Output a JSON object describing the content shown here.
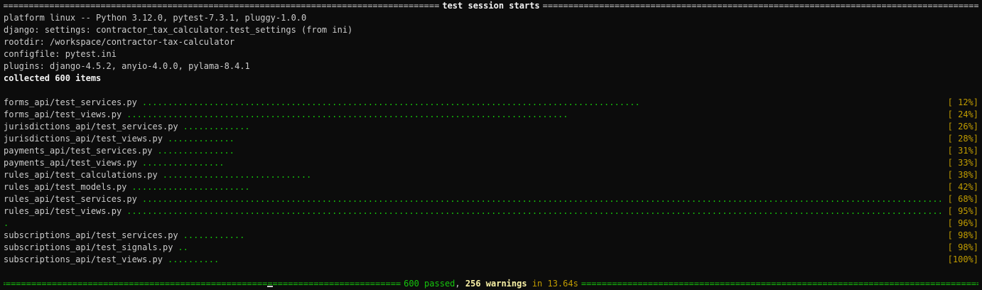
{
  "session_header": "test session starts",
  "info_lines": [
    "platform linux -- Python 3.12.0, pytest-7.3.1, pluggy-1.0.0",
    "django: settings: contractor_tax_calculator.test_settings (from ini)",
    "rootdir: /workspace/contractor-tax-calculator",
    "configfile: pytest.ini",
    "plugins: django-4.5.2, anyio-4.0.0, pylama-8.4.1"
  ],
  "collected": "collected 600 items",
  "results": [
    {
      "file": "forms_api/test_services.py",
      "dots": 97,
      "pct": "[ 12%]"
    },
    {
      "file": "forms_api/test_views.py",
      "dots": 86,
      "pct": "[ 24%]"
    },
    {
      "file": "jurisdictions_api/test_services.py",
      "dots": 13,
      "pct": "[ 26%]"
    },
    {
      "file": "jurisdictions_api/test_views.py",
      "dots": 13,
      "pct": "[ 28%]"
    },
    {
      "file": "payments_api/test_services.py",
      "dots": 15,
      "pct": "[ 31%]"
    },
    {
      "file": "payments_api/test_views.py",
      "dots": 16,
      "pct": "[ 33%]"
    },
    {
      "file": "rules_api/test_calculations.py",
      "dots": 29,
      "pct": "[ 38%]"
    },
    {
      "file": "rules_api/test_models.py",
      "dots": 23,
      "pct": "[ 42%]"
    },
    {
      "file": "rules_api/test_services.py",
      "dots": 157,
      "pct": "[ 68%]"
    },
    {
      "file": "rules_api/test_views.py",
      "dots": 164,
      "pct": "[ 95%]"
    },
    {
      "file": "",
      "dots": 1,
      "pct": "[ 96%]"
    },
    {
      "file": "subscriptions_api/test_services.py",
      "dots": 12,
      "pct": "[ 98%]"
    },
    {
      "file": "subscriptions_api/test_signals.py",
      "dots": 2,
      "pct": "[ 98%]"
    },
    {
      "file": "subscriptions_api/test_views.py",
      "dots": 10,
      "pct": "[100%]"
    }
  ],
  "summary": {
    "passed": "600 passed",
    "comma": ",",
    "warnings": "256 warnings",
    "time": "in 13.64s"
  },
  "colors": {
    "background": "#0c0c0c",
    "text": "#cccccc",
    "green": "#16c60c",
    "yellow": "#c19c00"
  }
}
